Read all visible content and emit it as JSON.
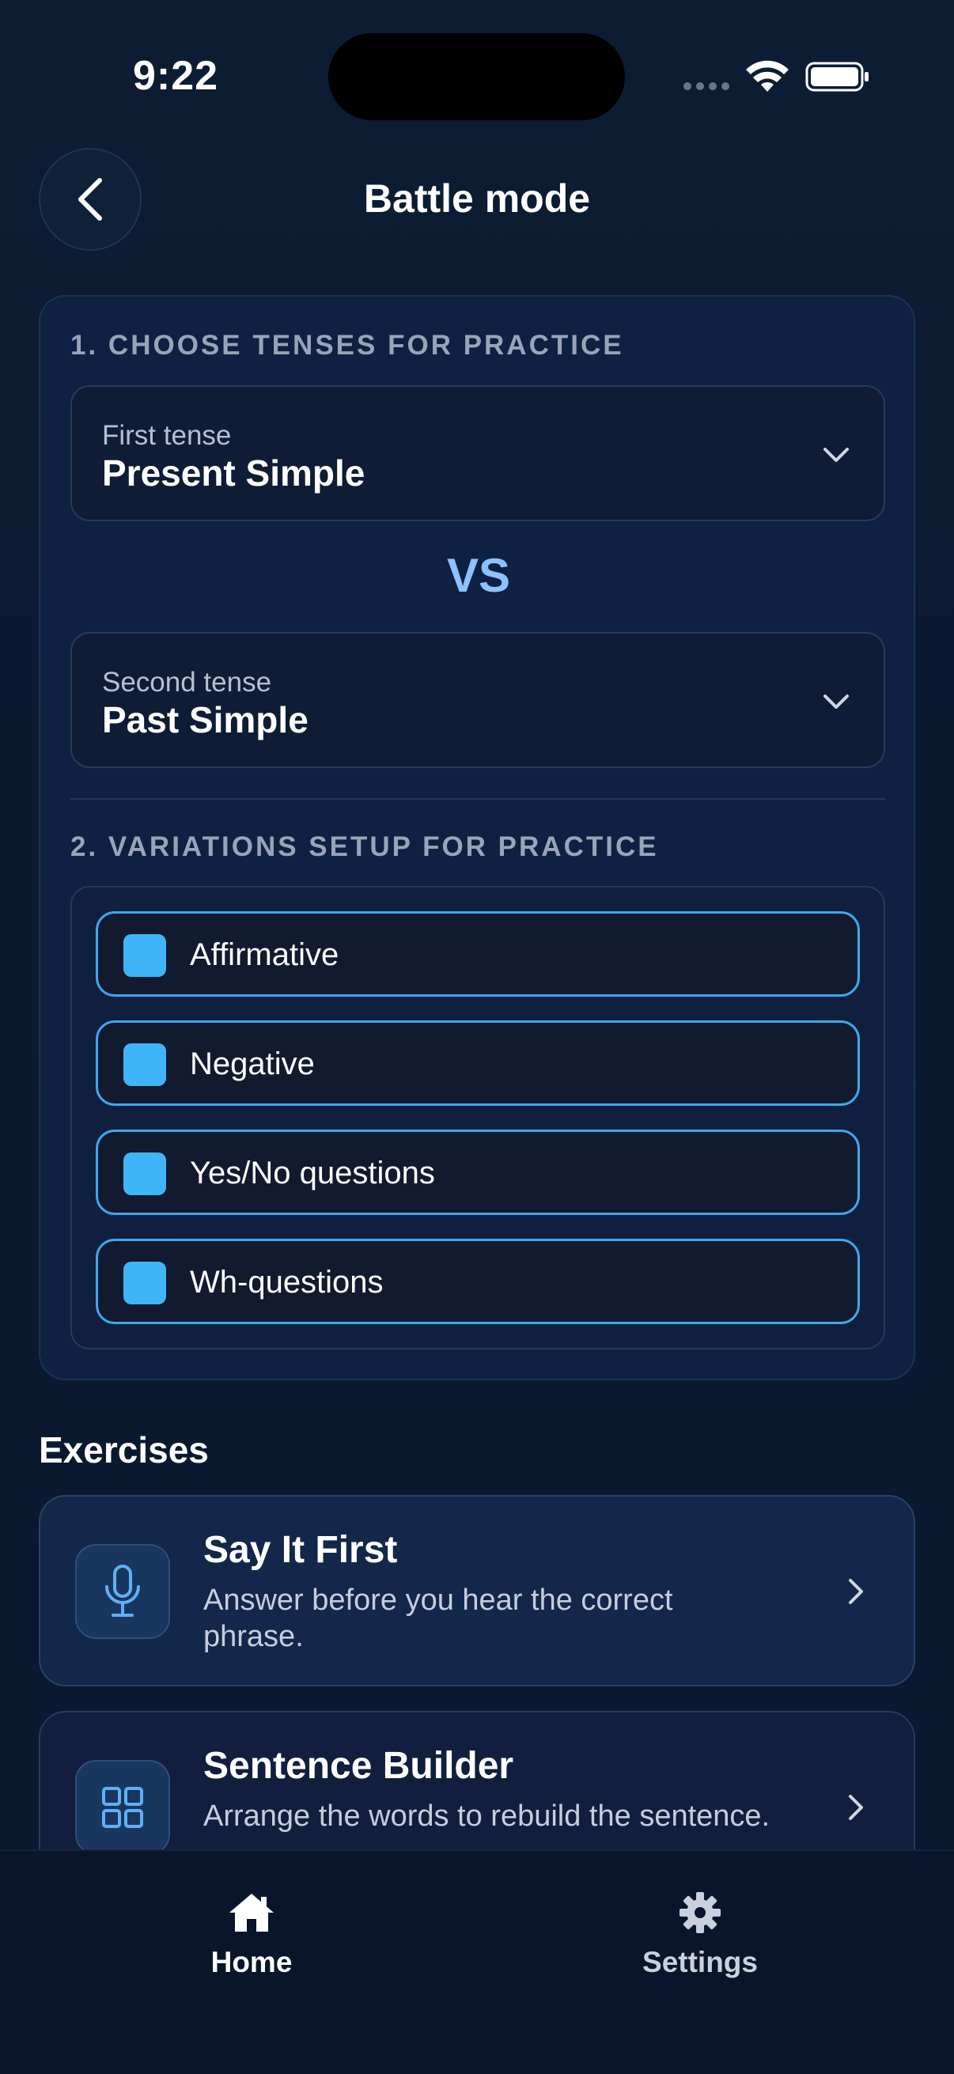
{
  "status_bar": {
    "time": "9:22"
  },
  "header": {
    "title": "Battle mode"
  },
  "tenses": {
    "heading": "1. CHOOSE TENSES FOR PRACTICE",
    "first": {
      "label": "First tense",
      "value": "Present Simple"
    },
    "vs": "VS",
    "second": {
      "label": "Second tense",
      "value": "Past Simple"
    }
  },
  "variations": {
    "heading": "2. VARIATIONS SETUP FOR PRACTICE",
    "items": [
      {
        "label": "Affirmative",
        "checked": true
      },
      {
        "label": "Negative",
        "checked": true
      },
      {
        "label": "Yes/No questions",
        "checked": true
      },
      {
        "label": "Wh-questions",
        "checked": true
      }
    ]
  },
  "exercises": {
    "heading": "Exercises",
    "items": [
      {
        "title": "Say It First",
        "description": "Answer before you hear the correct phrase.",
        "icon": "microphone-icon"
      },
      {
        "title": "Sentence Builder",
        "description": "Arrange the words to rebuild the sentence.",
        "icon": "grid-icon"
      }
    ]
  },
  "tab_bar": {
    "items": [
      {
        "label": "Home",
        "icon": "home-icon",
        "active": true
      },
      {
        "label": "Settings",
        "icon": "gear-icon",
        "active": false
      }
    ]
  },
  "colors": {
    "accent": "#3fb4f7",
    "vs": "#8ec2ff",
    "background": "#0b1a30"
  }
}
